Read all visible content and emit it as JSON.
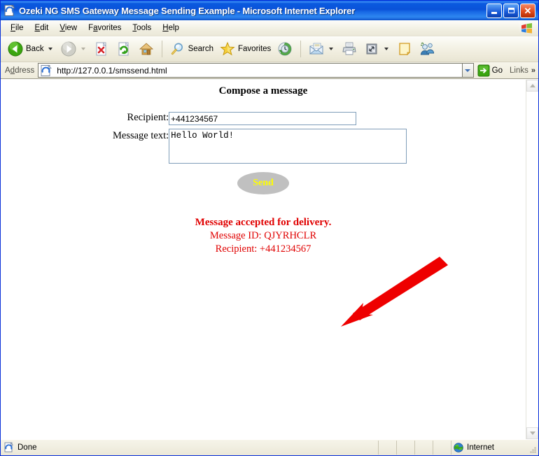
{
  "window": {
    "title": "Ozeki NG SMS Gateway Message Sending Example - Microsoft Internet Explorer",
    "icon": "ie-document-icon",
    "minimize_label": "Minimize",
    "maximize_label": "Maximize",
    "close_label": "Close"
  },
  "menubar": {
    "items": [
      {
        "label": "File",
        "accel": "F"
      },
      {
        "label": "Edit",
        "accel": "E"
      },
      {
        "label": "View",
        "accel": "V"
      },
      {
        "label": "Favorites",
        "accel": "a"
      },
      {
        "label": "Tools",
        "accel": "T"
      },
      {
        "label": "Help",
        "accel": "H"
      }
    ],
    "brand_icon": "windows-flag-icon"
  },
  "toolbar": {
    "back_label": "Back",
    "forward_label": "",
    "stop_label": "",
    "refresh_label": "",
    "home_label": "",
    "search_label": "Search",
    "favorites_label": "Favorites",
    "history_label": "",
    "mail_label": "",
    "print_label": "",
    "edit_label": "",
    "discuss_label": "",
    "messenger_label": ""
  },
  "address": {
    "label": "Address",
    "url": "http://127.0.0.1/smssend.html",
    "placeholder": "",
    "go_label": "Go",
    "links_label": "Links",
    "overflow_glyph": "»"
  },
  "page": {
    "heading": "Compose a message",
    "recipient_label": "Recipient:",
    "recipient_value": "+441234567",
    "recipient_placeholder": "",
    "message_label": "Message text:",
    "message_value": "Hello World!",
    "message_placeholder": "",
    "send_label": "Send",
    "send_text_color": "#ffff00",
    "send_bg_color": "#c0c0c0",
    "result_color": "#e00000",
    "result_line1": "Message accepted for delivery.",
    "result_line2": "Message ID: QJYRHCLR",
    "result_line3": "Recipient: +441234567",
    "annotation_arrow_color": "#ee0000"
  },
  "statusbar": {
    "status_text": "Done",
    "status_icon": "ie-document-icon",
    "zone_text": "Internet",
    "zone_icon": "globe-icon"
  }
}
